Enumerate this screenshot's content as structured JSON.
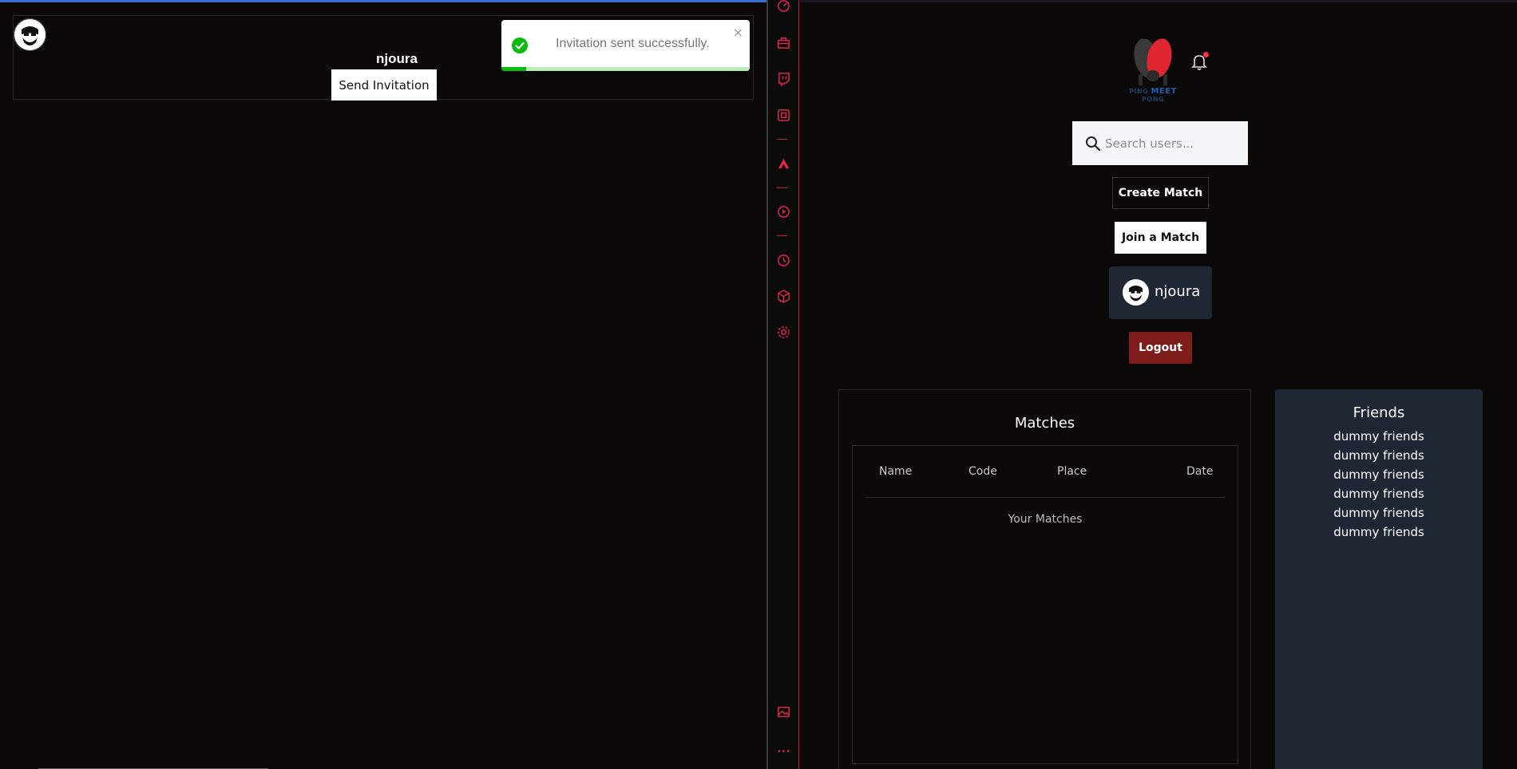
{
  "left": {
    "username": "njoura",
    "send_invitation_label": "Send Invitation",
    "toast": {
      "message": "Invitation sent successfully.",
      "close_glyph": "×",
      "status_color": "#07bc0c",
      "progress_fraction": 0.1
    }
  },
  "sidebar": {
    "icons": [
      "speedometer-icon",
      "toolbox-icon",
      "twitch-icon",
      "chip-icon",
      "flame-icon",
      "play-circle-icon",
      "clock-icon",
      "cube-icon",
      "gear-icon",
      "image-icon",
      "more-dots-icon"
    ],
    "accent_color": "#e0234b"
  },
  "right": {
    "logo": {
      "left_word": "PING",
      "middle_word": "MEET",
      "right_word": "PONG"
    },
    "search": {
      "placeholder": "Search users..."
    },
    "create_match_label": "Create Match",
    "join_match_label": "Join a Match",
    "profile_name": "njoura",
    "logout_label": "Logout",
    "logout_color": "#7f1d1d",
    "matches": {
      "title": "Matches",
      "columns": [
        "Name",
        "Code",
        "Place",
        "Date"
      ],
      "empty_text": "Your Matches"
    },
    "friends": {
      "title": "Friends",
      "items": [
        "dummy friends",
        "dummy friends",
        "dummy friends",
        "dummy friends",
        "dummy friends",
        "dummy friends"
      ]
    }
  }
}
